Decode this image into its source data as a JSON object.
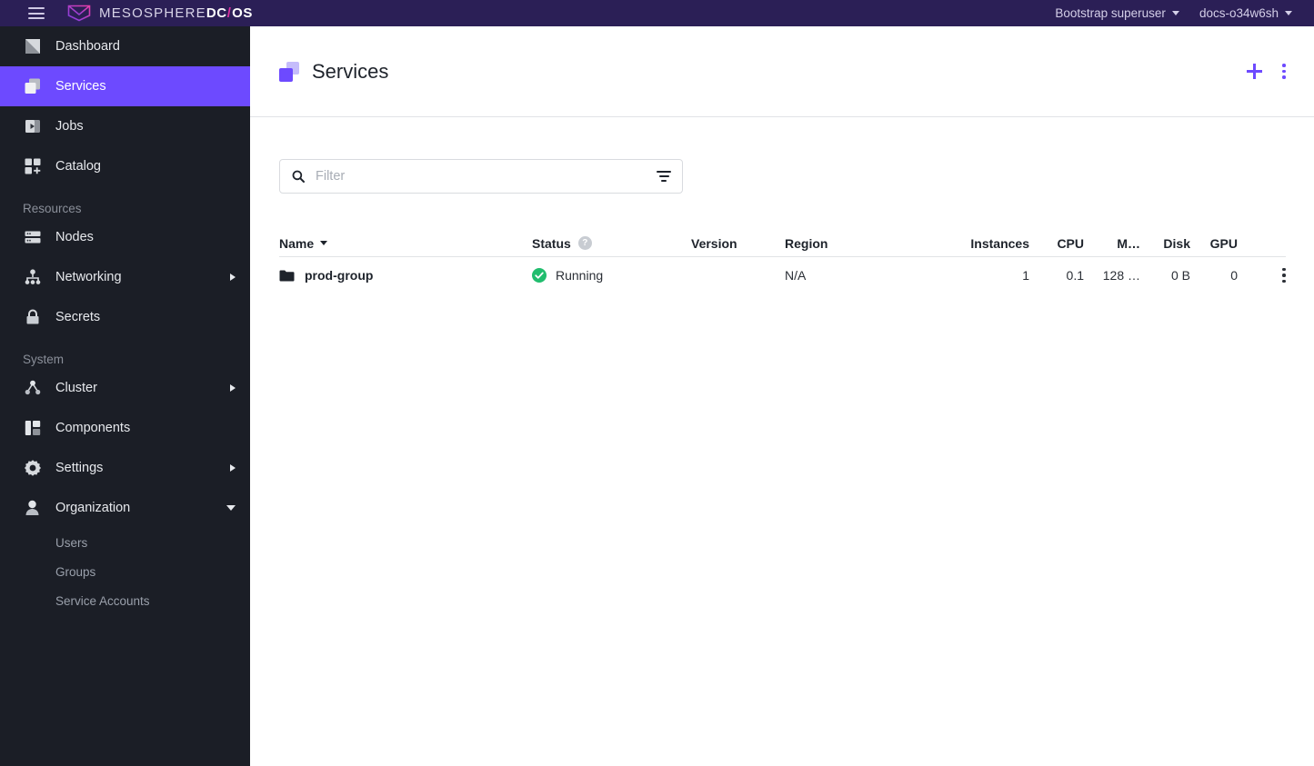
{
  "topbar": {
    "menu_icon": "hamburger-icon",
    "brand_prefix": "MESOSPHERE",
    "brand_dc": "DC",
    "brand_slash": "/",
    "brand_os": "OS",
    "user_menu": "Bootstrap superuser",
    "cluster_menu": "docs-o34w6sh",
    "background": "#2b1f56",
    "accent_pink": "#d92fa0"
  },
  "sidebar": {
    "background": "#1b1e26",
    "active_color": "#6d4aff",
    "primary_items": [
      {
        "label": "Dashboard",
        "icon": "dashboard-icon",
        "active": false
      },
      {
        "label": "Services",
        "icon": "services-icon",
        "active": true
      },
      {
        "label": "Jobs",
        "icon": "jobs-icon",
        "active": false
      },
      {
        "label": "Catalog",
        "icon": "catalog-icon",
        "active": false
      }
    ],
    "resources_header": "Resources",
    "resources_items": [
      {
        "label": "Nodes",
        "icon": "nodes-icon",
        "expandable": false
      },
      {
        "label": "Networking",
        "icon": "networking-icon",
        "expandable": true
      },
      {
        "label": "Secrets",
        "icon": "lock-icon",
        "expandable": false
      }
    ],
    "system_header": "System",
    "system_items": [
      {
        "label": "Cluster",
        "icon": "cluster-icon",
        "expandable": true
      },
      {
        "label": "Components",
        "icon": "components-icon",
        "expandable": false
      },
      {
        "label": "Settings",
        "icon": "gear-icon",
        "expandable": true
      },
      {
        "label": "Organization",
        "icon": "user-icon",
        "expandable": true,
        "expanded": true
      }
    ],
    "organization_children": [
      {
        "label": "Users"
      },
      {
        "label": "Groups"
      },
      {
        "label": "Service Accounts"
      }
    ]
  },
  "page": {
    "title": "Services",
    "icon": "services-icon",
    "add_button": "add-icon",
    "more_button": "more-vertical-icon"
  },
  "filter": {
    "placeholder": "Filter",
    "value": "",
    "search_icon": "search-icon",
    "funnel_icon": "filter-icon"
  },
  "table": {
    "columns": [
      {
        "key": "name",
        "label": "Name",
        "sorted": true,
        "sort_dir": "desc"
      },
      {
        "key": "status",
        "label": "Status",
        "help": "?"
      },
      {
        "key": "version",
        "label": "Version"
      },
      {
        "key": "region",
        "label": "Region"
      },
      {
        "key": "instances",
        "label": "Instances"
      },
      {
        "key": "cpu",
        "label": "CPU"
      },
      {
        "key": "mem",
        "label": "M…"
      },
      {
        "key": "disk",
        "label": "Disk"
      },
      {
        "key": "gpu",
        "label": "GPU"
      }
    ],
    "rows": [
      {
        "name": "prod-group",
        "name_icon": "folder-icon",
        "status": "Running",
        "status_icon": "check-circle-icon",
        "status_color": "#21bd6e",
        "version": "",
        "region": "N/A",
        "instances": "1",
        "cpu": "0.1",
        "mem": "128 …",
        "disk": "0 B",
        "gpu": "0",
        "row_menu": "more-vertical-icon"
      }
    ]
  }
}
